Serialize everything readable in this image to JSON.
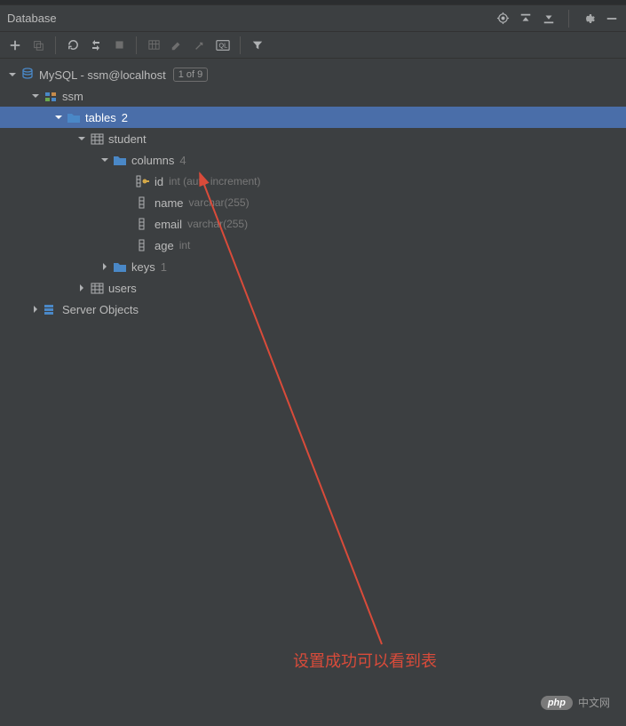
{
  "panel": {
    "title": "Database"
  },
  "tree": {
    "datasource": {
      "label": "MySQL - ssm@localhost",
      "badge": "1 of 9"
    },
    "schema": {
      "label": "ssm"
    },
    "tables_group": {
      "label": "tables",
      "count": "2"
    },
    "table_student": {
      "label": "student"
    },
    "columns_group": {
      "label": "columns",
      "count": "4"
    },
    "col_id": {
      "label": "id",
      "meta": "int (auto increment)"
    },
    "col_name": {
      "label": "name",
      "meta": "varchar(255)"
    },
    "col_email": {
      "label": "email",
      "meta": "varchar(255)"
    },
    "col_age": {
      "label": "age",
      "meta": "int"
    },
    "keys_group": {
      "label": "keys",
      "count": "1"
    },
    "table_users": {
      "label": "users"
    },
    "server_objects": {
      "label": "Server Objects"
    }
  },
  "annotation": {
    "text": "设置成功可以看到表"
  },
  "watermark": {
    "badge": "php",
    "text": "中文网"
  }
}
